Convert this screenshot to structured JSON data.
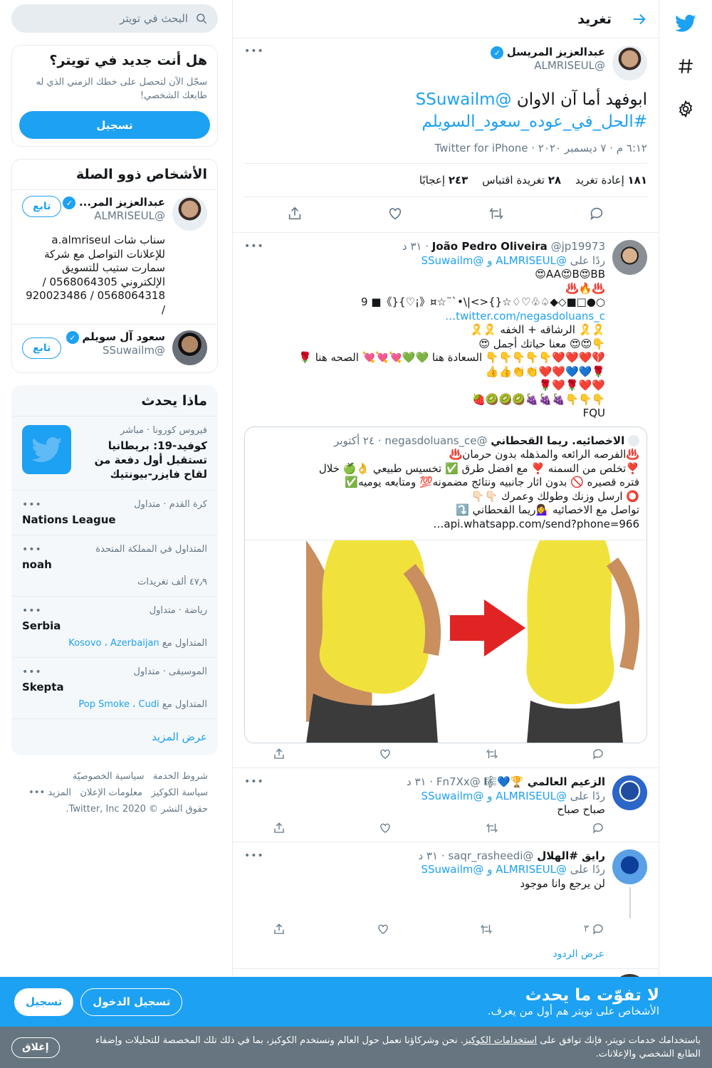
{
  "colors": {
    "accent": "#1da1f2",
    "text": "#14171a",
    "secondary": "#657786",
    "border": "#e6ecf0"
  },
  "header": {
    "title": "تغريد"
  },
  "focal_tweet": {
    "name": "عبدالعزيز المريسل",
    "handle": "@ALMRISEUL",
    "text_line1": "ابوفهد أما آن الاوان",
    "mention": "@SSuwailm",
    "hashtag": "#الحل_في_عوده_سعود_السويلم",
    "meta": "٦:١٢ م · ٧ ديسمبر ٢٠٢٠ · Twitter for iPhone",
    "retweets_count": "١٨١",
    "retweets_label": "إعادة تغريد",
    "quotes_count": "٢٨",
    "quotes_label": "تغريدة اقتباس",
    "likes_count": "٢٤٣",
    "likes_label": "إعجابًا"
  },
  "replies": [
    {
      "name": "João Pedro Oliveira",
      "handle": "@jp19973",
      "time": "· ٣١ د",
      "reply_to_prefix": "ردًا على",
      "reply_to": "@ALMRISEUL و @SSuwailm",
      "lines": [
        "AA😍B😍BB😍",
        "♨️🔥♨️",
        "○●□■◇◆♤♧♡♢☆{}<>|\\•`¨☆¤《¡♡}{》■ 9",
        "twitter.com/negasdoluans_c…",
        "🎗️🎗️ الرشاقه + الخفه 🎗️🎗️",
        "👇😍😍 معنا حياتك أجمل 😍",
        "💔❤️❤️❤️👇👇👇👇👇 السعادة هنا 💚💚💘💘💘 الصحه هنا 🌹",
        "🌹💙💙❤️❤️👏👏👍👍",
        "❤️❤️🌹❤️🌹",
        "👇👇👇🍇🍇🍇🥝🥝🥝🍓",
        "FQU"
      ],
      "quote": {
        "name": "الاخصائيه. ريما القحطاني",
        "handle": "@negasdoluans_ce",
        "time": "· ٢٤ أكتوبر",
        "lines": [
          "♨️الفرصه الرائعه والمذهله بدون حرمان♨️",
          "❣️تخلص من السمنه ❣️ مع افضل طرق ✅ تخسيس طبيعي 👌🍏 خلال",
          "فتره قصيره 🚫 بدون اثار جانبيه ونتائج مضمونه💯 ومتابعه يوميه✅",
          "⭕ ارسل وزنك وطولك وعمرك 👇🏻👇🏻",
          "تواصل مع الاخصائيه 💁‍♀️ريما القحطاني ⤵️",
          "api.whatsapp.com/send?phone=966…"
        ]
      }
    },
    {
      "name": "الزعيم العالمي 🏆💙🎼",
      "handle": "@Fn7Xx",
      "time": "· ٣١ د",
      "reply_to_prefix": "ردًا على",
      "reply_to": "@ALMRISEUL و @SSuwailm",
      "text": "صباح صباح"
    },
    {
      "name": "رايق #الهلال",
      "handle": "@saqr_rasheedi",
      "time": "· ٣١ د",
      "reply_to_prefix": "ردًا على",
      "reply_to": "@ALMRISEUL و @SSuwailm",
      "text": "لن يرجع وانا موجود",
      "reply_count": "٣",
      "show_replies": "عرض الردود"
    }
  ],
  "sidebar": {
    "search_placeholder": "البحث في تويتر",
    "new_title": "هل أنت جديد في تويتر؟",
    "new_sub": "سجّل الآن لتحصل على خطك الزمني الذي له طابعك الشخصي!",
    "signup": "تسجيل",
    "related_title": "الأشخاص ذوو الصلة",
    "people": [
      {
        "name": "عبدالعزيز المر...",
        "handle": "@ALMRISEUL",
        "follow": "تابع",
        "bio": "سناب شات a.almriseul للإعلانات التواصل مع شركة سمارت ستيب للتسويق الإلكتروني 0568064305 / 0568064318 / 920023486 /"
      },
      {
        "name": "سعود آل سويلم",
        "handle": "@SSuwailm",
        "follow": "تابع"
      }
    ],
    "trends_title": "ماذا يحدث",
    "trends": [
      {
        "context": "فيروس كورونا · مباشر",
        "title": "كوفيد-19: بريطانيا تستقبل أول دفعة من لقاح فايزر-بيونتيك"
      },
      {
        "context": "كرة القدم · متداول",
        "title": "Nations League"
      },
      {
        "context": "المتداول في المملكة المتحدة",
        "title": "noah",
        "extra": "٤٧٫٩ ألف تغريدات"
      },
      {
        "context": "رياضة · متداول",
        "title": "Serbia",
        "with": "المتداول مع",
        "links": "Kosovo ، Azerbaijan"
      },
      {
        "context": "الموسيقى · متداول",
        "title": "Skepta",
        "with": "المتداول مع",
        "links": "Pop Smoke ، Cudi"
      }
    ],
    "show_more": "عرض المزيد",
    "footer": {
      "terms": "شروط الخدمة",
      "privacy": "سياسية الخصوصيّة",
      "cookies": "سياسة الكوكيز",
      "ads": "معلومات الإعلان",
      "more": "المزيد",
      "copyright": "حقوق النشر © 2020 Twitter, Inc."
    }
  },
  "bottom_bar": {
    "title": "لا تفوّت ما يحدث",
    "sub": "الأشخاص على تويتر هم أول من يعرف.",
    "login": "تسجيل الدخول",
    "signup": "تسجيل"
  },
  "cookie_bar": {
    "text_pre": "باستخدامك خدمات تويتر، فإنك توافق على",
    "link": "استخدامات الكوكيز",
    "text_post": ". نحن وشركاؤنا نعمل حول العالم ونستخدم الكوكيز، بما في ذلك تلك المخصصة للتحليلات وإضفاء الطابع الشخصي والإعلانات.",
    "close": "إغلاق"
  }
}
